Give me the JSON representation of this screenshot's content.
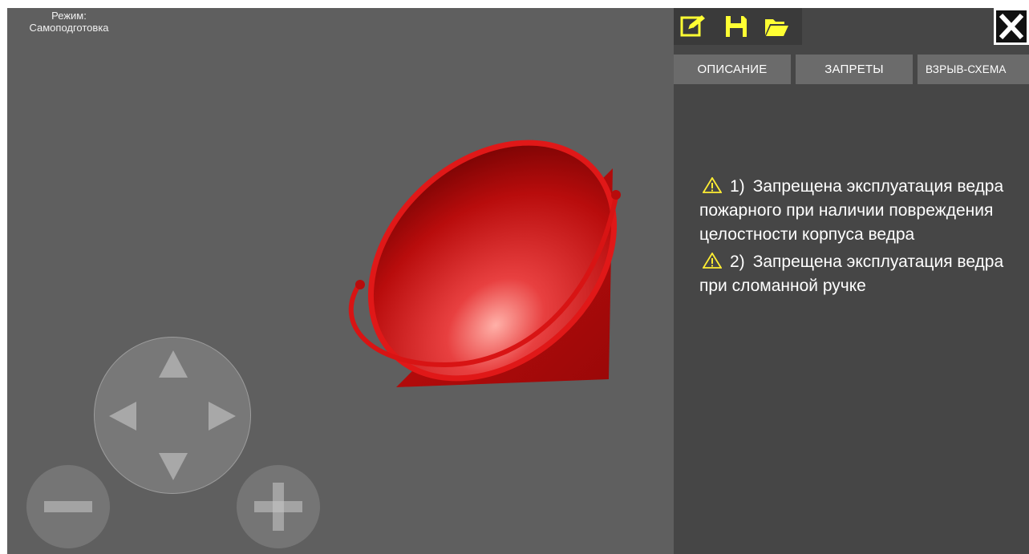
{
  "app": {
    "mode_label": "Режим:",
    "mode_value": "Самоподготовка"
  },
  "toolbar": {
    "icons": [
      "pencil-icon",
      "save-icon",
      "folder-icon"
    ],
    "accent_color": "#ffff33"
  },
  "tabs": [
    {
      "label": "ОПИСАНИЕ"
    },
    {
      "label": "ЗАПРЕТЫ"
    },
    {
      "label": "ВЗРЫВ-СХЕМА"
    }
  ],
  "bans": [
    {
      "number": "1)",
      "text_first": "Запрещена",
      "text_rest": "эксплуатация ведра пожарного при наличии повреждения целостности корпуса ведра"
    },
    {
      "number": "2)",
      "text_first": "Запрещена",
      "text_rest": "эксплуатация ведра при сломанной ручке"
    }
  ],
  "colors": {
    "viewport_bg": "#5f5f5f",
    "panel_bg": "#464646",
    "tab_bg": "#6b6b6b",
    "model_red": "#d01010",
    "warning_yellow": "#ffee33"
  }
}
